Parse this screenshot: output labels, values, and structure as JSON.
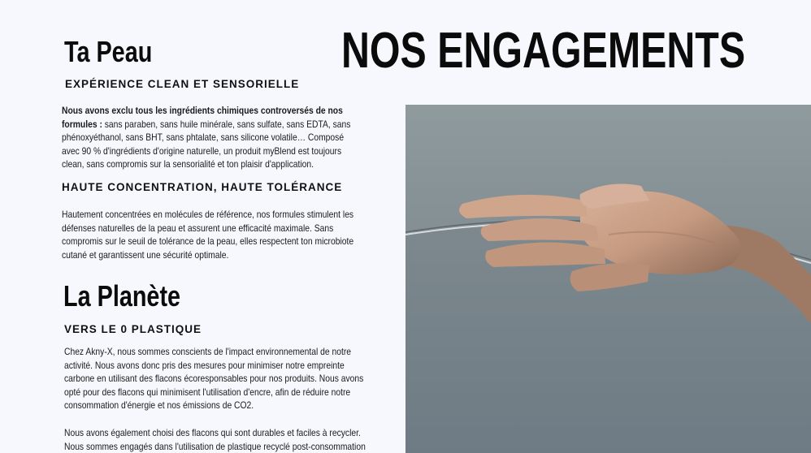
{
  "heading": {
    "main": "NOS ENGAGEMENTS"
  },
  "skin": {
    "title": "Ta Peau",
    "clean": {
      "subtitle": "EXPÉRIENCE CLEAN ET SENSORIELLE",
      "lead": "Nous avons exclu tous les ingrédients chimiques controversés de nos formules :",
      "text": " sans paraben, sans huile minérale, sans sulfate, sans EDTA, sans phénoxyéthanol, sans BHT, sans phtalate, sans silicone volatile… Composé avec 90 % d'ingrédients d'origine naturelle, un produit myBlend est toujours clean, sans compromis sur la sensorialité et ton plaisir d'application."
    },
    "tolerance": {
      "subtitle": "HAUTE CONCENTRATION, HAUTE TOLÉRANCE",
      "text": "Hautement concentrées en molécules de référence, nos formules stimulent les défenses naturelles de la peau et assurent une efficacité maximale. Sans compromis sur le seuil de tolérance de la peau, elles respectent ton microbiote cutané et garantissent une sécurité optimale."
    }
  },
  "planet": {
    "title": "La Planète",
    "subtitle": "VERS LE 0 PLASTIQUE",
    "text_1": "Chez Akny-X, nous sommes conscients de l'impact environnemental de notre activité. Nous avons donc pris des mesures pour minimiser notre empreinte carbone en utilisant des flacons écoresponsables pour nos produits. Nous avons opté pour des flacons qui minimisent l'utilisation d'encre, afin de réduire notre consommation d'énergie et nos émissions de CO2.",
    "text_2": "Nous avons également choisi des flacons qui sont durables et faciles à recycler. Nous sommes engagés dans l'utilisation de plastique recyclé post-consommation"
  },
  "photo": {
    "subject": "hand-over-mirror-photo",
    "colors": {
      "background": "#7f8b8f",
      "skin": "#c59a80",
      "mirror_edge": "#d9dde0"
    }
  }
}
